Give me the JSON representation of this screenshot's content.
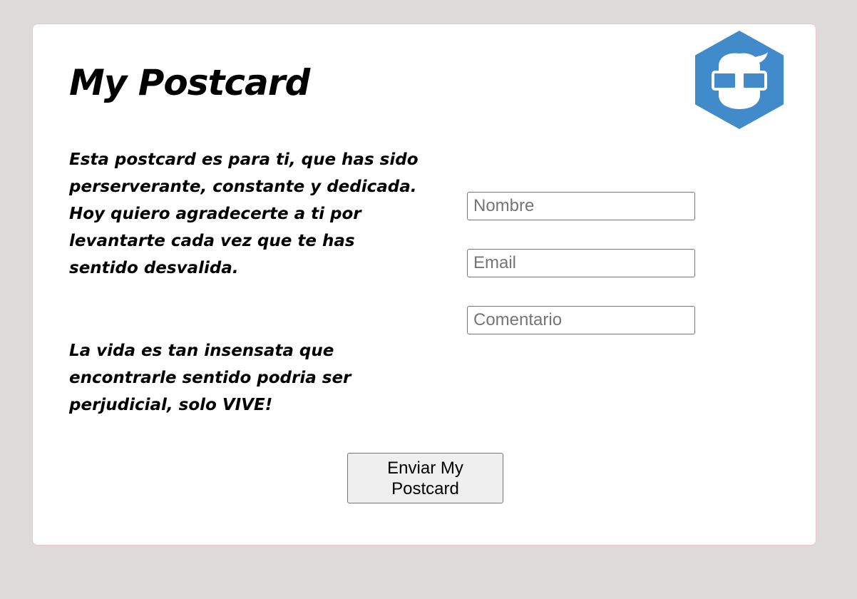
{
  "postcard": {
    "title": "My Postcard",
    "logo_icon": "nerd-glasses-hexagon-icon",
    "logo_color": "#428bca",
    "message_paragraph_1": "Esta postcard es para ti, que has sido perserverante, constante y dedicada. Hoy quiero agradecerte a ti por levantarte cada vez que te has sentido desvalida.",
    "message_paragraph_2": "La vida es tan insensata que encontrarle sentido podria ser perjudicial, solo VIVE!"
  },
  "form": {
    "name_field": {
      "value": "",
      "placeholder": "Nombre"
    },
    "email_field": {
      "value": "",
      "placeholder": "Email"
    },
    "comment_field": {
      "value": "",
      "placeholder": "Comentario"
    },
    "submit_label": "Enviar My Postcard"
  }
}
